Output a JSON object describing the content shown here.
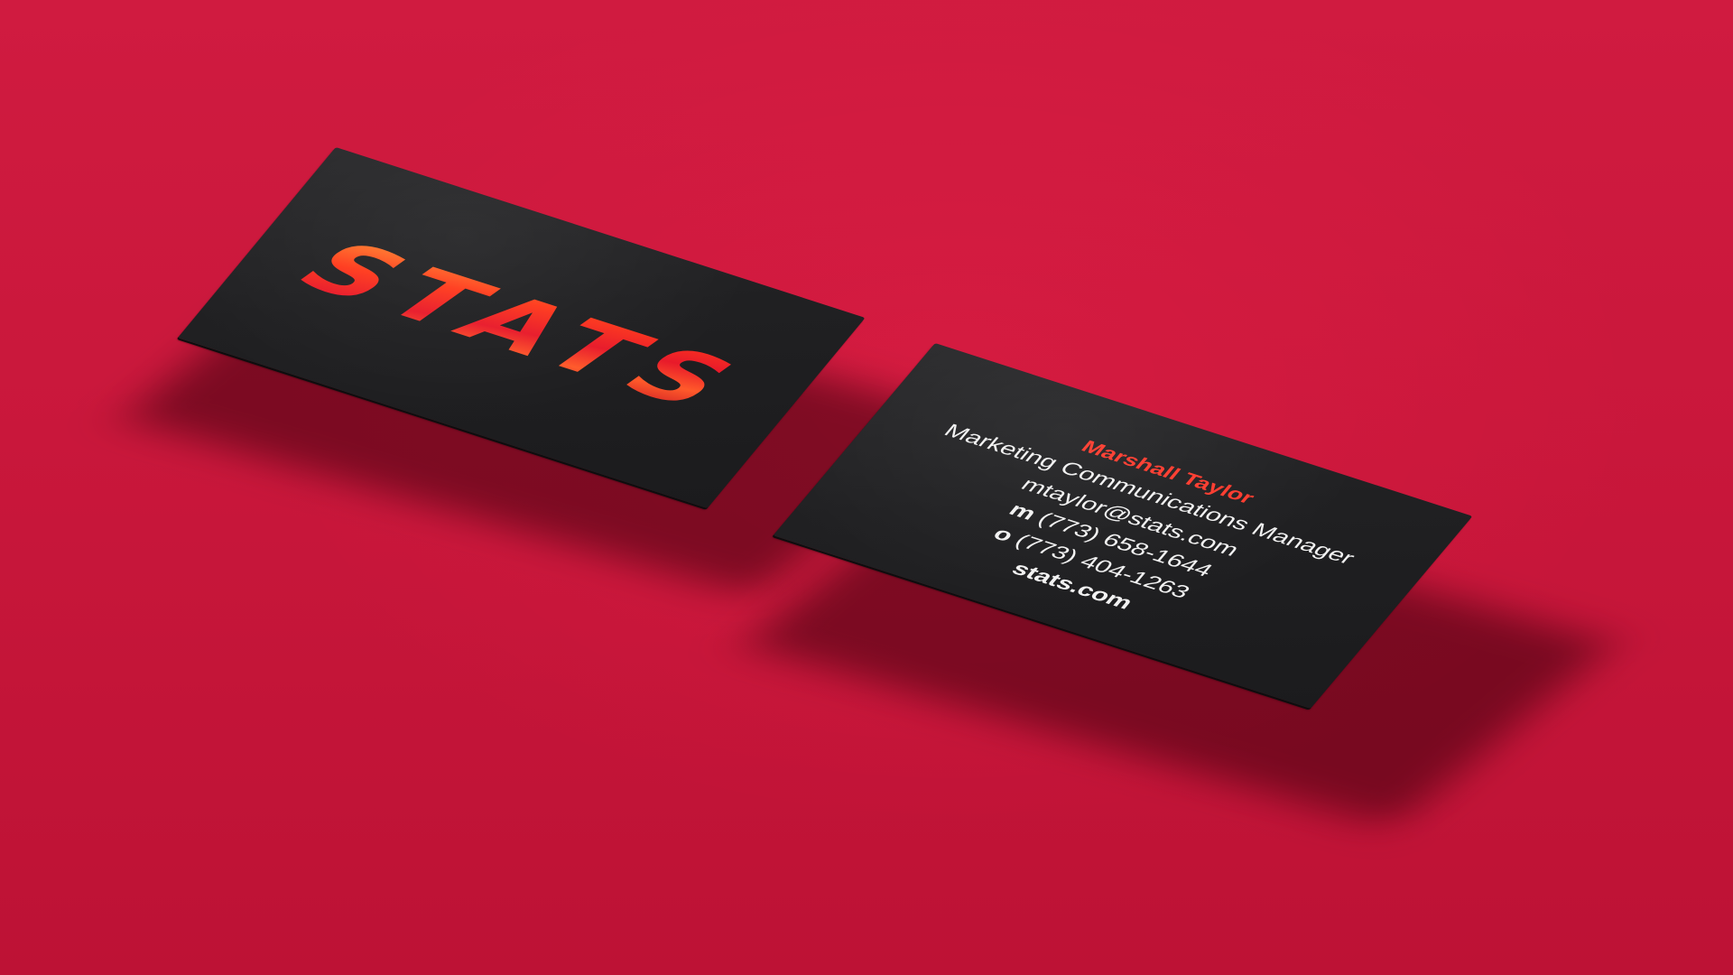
{
  "scene": {
    "background_color": "#c8183a",
    "card_color": "#1f1f21"
  },
  "front_card": {
    "logo_text": "STATS",
    "logo_color": "#ff2a1e"
  },
  "back_card": {
    "name": "Marshall Taylor",
    "name_color": "#ff3b2e",
    "title": "Marketing Communications Manager",
    "email": "mtaylor@stats.com",
    "mobile_prefix": "m",
    "mobile": "(773) 658-1644",
    "office_prefix": "o",
    "office": "(773) 404-1263",
    "website": "stats.com"
  }
}
